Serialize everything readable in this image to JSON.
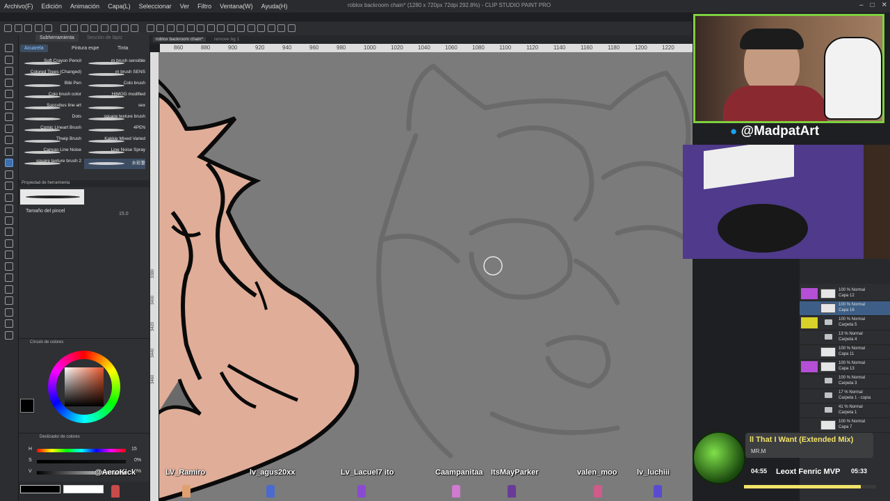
{
  "menu": [
    "Archivo(F)",
    "Edición",
    "Animación",
    "Capa(L)",
    "Seleccionar",
    "Ver",
    "Filtro",
    "Ventana(W)",
    "Ayuda(H)"
  ],
  "window_title": "roblox backroom chain* (1280 x 720px 72dpi 292.8%) - CLIP STUDIO PAINT PRO",
  "subtool": {
    "header_tabs": [
      "Subherramienta",
      "Sección de lápiz"
    ],
    "tabs": [
      "Acuarela",
      "Pintura espe",
      "Tinta"
    ],
    "brushes": [
      "Soft Crayon Pencil",
      "m brush sensible",
      "Colored Trees (Changed)",
      "m brush SENS",
      "Bibi Pen",
      "Colo brush",
      "Colo brush color",
      "HIMOG modified",
      "Succubus line art",
      "sex",
      "Dots",
      "square texture brush",
      "Comic Lineart Brush",
      "4PEN",
      "Thwip Brush",
      "Kakkie Mixed Varied",
      "Canvas Line Noise",
      "Line Noise Spray",
      "square texture brush 2",
      "水彩筆"
    ],
    "tool_property_title": "Propiedad de herramienta",
    "brush_size_label": "Tamaño del pincel",
    "brush_size_value": "15.0"
  },
  "color_circle_title": "Círculo de colores",
  "color_sliders": {
    "title": "Deslizador de colores",
    "h_label": "H",
    "h_value": "15",
    "s_label": "S",
    "s_value": "0%",
    "v_label": "V",
    "v_value": "0%"
  },
  "canvas_tabs": [
    "roblox backroom chain*",
    "remove bg 1"
  ],
  "ruler_ticks": [
    "860",
    "880",
    "900",
    "920",
    "940",
    "960",
    "980",
    "1000",
    "1020",
    "1040",
    "1060",
    "1080",
    "1100",
    "1120",
    "1140",
    "1160",
    "1180",
    "1200",
    "1220"
  ],
  "vruler_ticks": [
    "3380",
    "3400",
    "3420",
    "3440",
    "3460"
  ],
  "stream": {
    "handle": "@MadpatArt",
    "song_title": "ll That I Want (Extended Mix)",
    "song_artist": "MR.M",
    "time_elapsed": "04:55",
    "time_total": "05:33",
    "progress": 0.886,
    "now_playing_viewer": "Leoxt Fenric MVP",
    "viewers": [
      "@AeroKick",
      "LV_Ramiro",
      "lv_agus20xx",
      "Lv_Lacuel7 ito",
      "Caampanitaa",
      "ItsMayParker",
      "valen_moo",
      "lv_luchiii"
    ]
  },
  "layers": [
    {
      "opacity": "100 % Normal",
      "name": "Capa 12",
      "color": "#b44fd6",
      "type": "layer"
    },
    {
      "opacity": "100 % Normal",
      "name": "Capa 16",
      "color": "",
      "type": "layer",
      "selected": true
    },
    {
      "opacity": "100 % Normal",
      "name": "Carpeta 5",
      "color": "#d8d12a",
      "type": "folder"
    },
    {
      "opacity": "13 % Normal",
      "name": "Carpeta 4",
      "color": "",
      "type": "folder"
    },
    {
      "opacity": "100 % Normal",
      "name": "Capa 11",
      "color": "",
      "type": "layer"
    },
    {
      "opacity": "100 % Normal",
      "name": "Capa 13",
      "color": "#b44fd6",
      "type": "layer"
    },
    {
      "opacity": "100 % Normal",
      "name": "Carpeta 3",
      "color": "",
      "type": "folder"
    },
    {
      "opacity": "17 % Normal",
      "name": "Carpeta 1 - copia",
      "color": "",
      "type": "folder"
    },
    {
      "opacity": "41 % Normal",
      "name": "Carpeta 1",
      "color": "",
      "type": "folder"
    },
    {
      "opacity": "100 % Normal",
      "name": "Capa 7",
      "color": "",
      "type": "layer"
    }
  ],
  "colors": {
    "skin": "#e0ad98",
    "canvas_bg": "#7b7b7b",
    "sketch": "#6a6a6a",
    "cam_border": "#7fd13f",
    "song_accent": "#f2e36a"
  }
}
